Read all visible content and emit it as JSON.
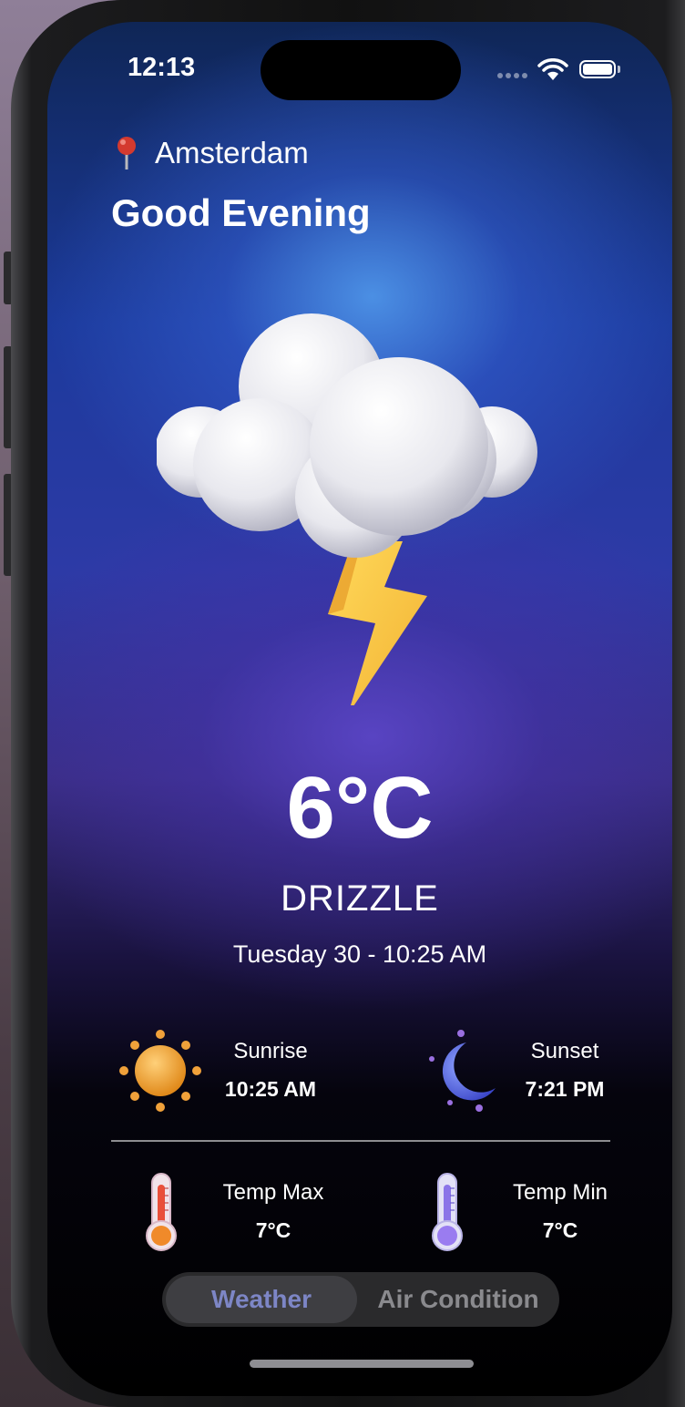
{
  "status_bar": {
    "time": "12:13"
  },
  "location": {
    "city": "Amsterdam",
    "icon": "map-pin-icon"
  },
  "greeting": "Good Evening",
  "weather": {
    "icon": "thunderstorm-cloud-icon",
    "temperature": "6°C",
    "condition": "DRIZZLE",
    "datetime": "Tuesday 30 -  10:25 AM"
  },
  "stats": {
    "sunrise": {
      "label": "Sunrise",
      "value": "10:25 AM",
      "icon": "sun-icon"
    },
    "sunset": {
      "label": "Sunset",
      "value": "7:21 PM",
      "icon": "moon-icon"
    },
    "temp_max": {
      "label": "Temp Max",
      "value": "7°C",
      "icon": "thermometer-hot-icon"
    },
    "temp_min": {
      "label": "Temp Min",
      "value": "7°C",
      "icon": "thermometer-cold-icon"
    }
  },
  "tabs": [
    {
      "label": "Weather",
      "active": true
    },
    {
      "label": "Air Condition",
      "active": false
    }
  ],
  "colors": {
    "active_tab_text": "#7d86c6",
    "inactive_tab_text": "#8a8a8e",
    "sky_top": "#1c3a9c",
    "glow_blue": "#4e94e8",
    "glow_purple": "#5c46c8"
  }
}
